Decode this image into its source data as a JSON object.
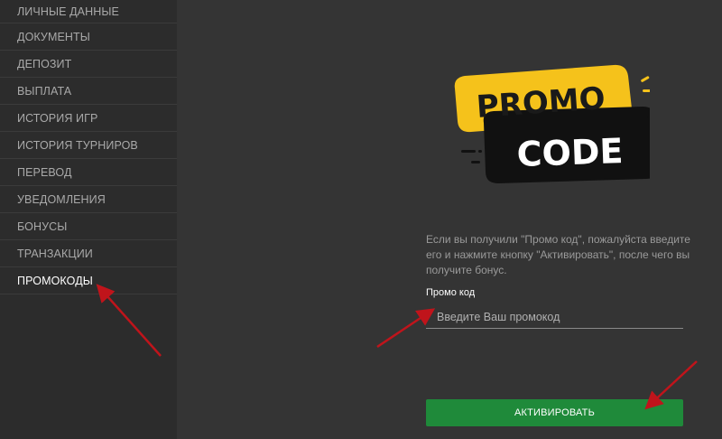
{
  "sidebar": {
    "items": [
      {
        "label": "ЛИЧНЫЕ ДАННЫЕ",
        "active": false
      },
      {
        "label": "ДОКУМЕНТЫ",
        "active": false
      },
      {
        "label": "ДЕПОЗИТ",
        "active": false
      },
      {
        "label": "ВЫПЛАТА",
        "active": false
      },
      {
        "label": "ИСТОРИЯ ИГР",
        "active": false
      },
      {
        "label": "ИСТОРИЯ ТУРНИРОВ",
        "active": false
      },
      {
        "label": "ПЕРЕВОД",
        "active": false
      },
      {
        "label": "УВЕДОМЛЕНИЯ",
        "active": false
      },
      {
        "label": "БОНУСЫ",
        "active": false
      },
      {
        "label": "ТРАНЗАКЦИИ",
        "active": false
      },
      {
        "label": "ПРОМОКОДЫ",
        "active": true
      }
    ]
  },
  "logo": {
    "line1": "PROMO",
    "line2": "CODE"
  },
  "promo": {
    "description": "Если вы получили \"Промо код\", пожалуйста введите его и нажмите кнопку \"Активировать\", после чего вы получите бонус.",
    "field_label": "Промо код",
    "placeholder": "Введите Ваш промокод",
    "button_label": "АКТИВИРОВАТЬ"
  },
  "colors": {
    "sidebar_bg": "#2c2c2c",
    "main_bg": "#343434",
    "button_green": "#1f8a3a",
    "logo_yellow": "#f5c21b",
    "arrow_red": "#c0141b"
  }
}
